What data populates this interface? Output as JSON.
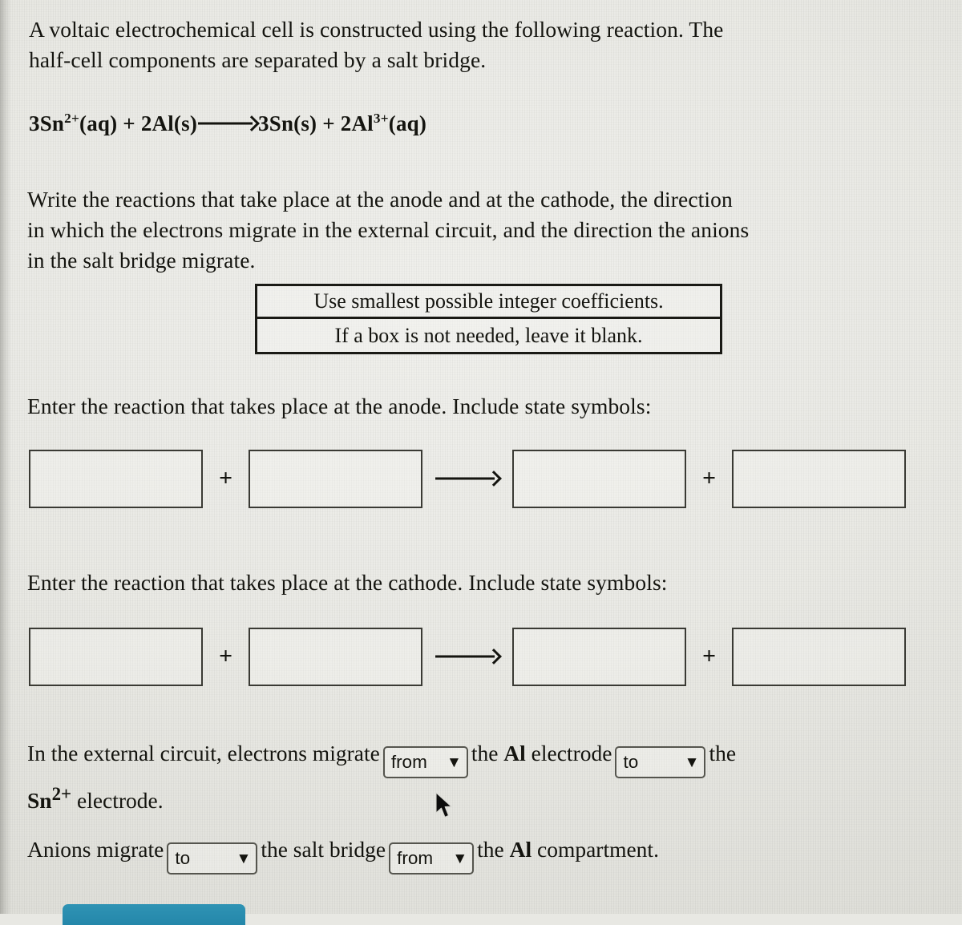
{
  "intro": {
    "line1": "A voltaic electrochemical cell is constructed using the following reaction. The",
    "line2": "half-cell components are separated by a salt bridge."
  },
  "equation": {
    "reactant1_coef": "3Sn",
    "reactant1_charge": "2+",
    "reactant1_state": "(aq)",
    "plus1": " + ",
    "reactant2": "2Al(s)",
    "product1": "3Sn(s)",
    "plus2": " + ",
    "product2_coef": "2Al",
    "product2_charge": "3+",
    "product2_state": "(aq)",
    "full_text": "3Sn2+(aq) + 2Al(s) ⟶ 3Sn(s) + 2Al3+(aq)"
  },
  "prompt": {
    "line1": "Write the reactions that take place at the anode and at the cathode, the direction",
    "line2": "in which the electrons migrate in the external circuit, and the direction the anions",
    "line3": "in the salt bridge migrate."
  },
  "note": {
    "line1": "Use smallest possible integer coefficients.",
    "line2": "If a box is not needed, leave it blank."
  },
  "anode": {
    "label": "Enter the reaction that takes place at the anode. Include state symbols:",
    "plus1": "+",
    "plus2": "+",
    "boxes": [
      {
        "name": "anode-reactant-1",
        "value": ""
      },
      {
        "name": "anode-reactant-2",
        "value": ""
      },
      {
        "name": "anode-product-1",
        "value": ""
      },
      {
        "name": "anode-product-2",
        "value": ""
      }
    ]
  },
  "cathode": {
    "label": "Enter the reaction that takes place at the cathode. Include state symbols:",
    "plus1": "+",
    "plus2": "+",
    "boxes": [
      {
        "name": "cathode-reactant-1",
        "value": ""
      },
      {
        "name": "cathode-reactant-2",
        "value": ""
      },
      {
        "name": "cathode-product-1",
        "value": ""
      },
      {
        "name": "cathode-product-2",
        "value": ""
      }
    ]
  },
  "electron_statement": {
    "text_before": "In the external circuit, electrons migrate",
    "dropdown1_value": "from",
    "text_middle": "the",
    "electrode1": "Al",
    "text_middle2": "electrode",
    "dropdown2_value": "to",
    "text_after": "the",
    "electrode2_symbol": "Sn",
    "electrode2_charge": "2+",
    "text_end": "electrode."
  },
  "anion_statement": {
    "text_before": "Anions migrate",
    "dropdown1_value": "to",
    "text_middle": "the salt bridge",
    "dropdown2_value": "from",
    "text_after": "the",
    "compartment": "Al",
    "text_end": "compartment."
  },
  "icons": {
    "chevron_down": "⌄",
    "cursor": "mouse-pointer-arrow"
  },
  "colors": {
    "background": "#e8e8e3",
    "text": "#14140f",
    "box_border": "#3a3a34",
    "note_border": "#1a1a15",
    "accent_button": "#2487aa"
  }
}
